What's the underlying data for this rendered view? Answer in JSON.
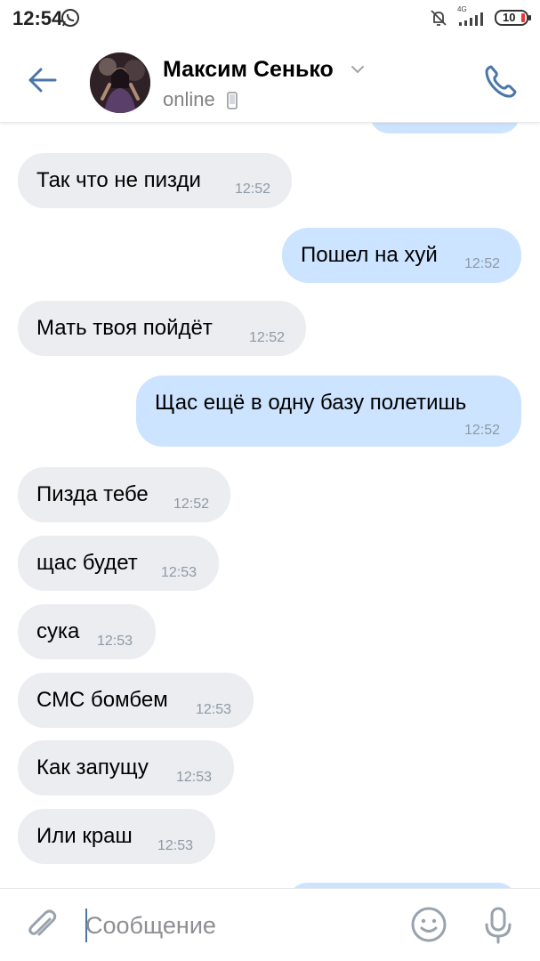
{
  "status_bar": {
    "time": "12:54",
    "network": "4G",
    "battery": "10",
    "icons": [
      "whatsapp-icon",
      "mute-icon",
      "signal-icon",
      "battery-icon"
    ]
  },
  "header": {
    "contact_name": "Максим Сенько",
    "status": "online",
    "icons": [
      "back-arrow-icon",
      "chevron-down-icon",
      "mobile-phone-icon",
      "phone-call-icon"
    ],
    "accent_color": "#4a76a8"
  },
  "messages": [
    {
      "direction": "in",
      "text": "Так что не пизди",
      "time": "12:52"
    },
    {
      "direction": "out",
      "text": "Пошел на хуй",
      "time": "12:52"
    },
    {
      "direction": "in",
      "text": "Мать твоя пойдёт",
      "time": "12:52"
    },
    {
      "direction": "out",
      "text": "Щас ещё в одну базу полетишь",
      "time": "12:52"
    },
    {
      "direction": "in",
      "text": "Пизда тебе",
      "time": "12:52"
    },
    {
      "direction": "in",
      "text": "щас будет",
      "time": "12:53"
    },
    {
      "direction": "in",
      "text": "сука",
      "time": "12:53"
    },
    {
      "direction": "in",
      "text": "СМС бомбем",
      "time": "12:53"
    },
    {
      "direction": "in",
      "text": "Как запущу",
      "time": "12:53"
    },
    {
      "direction": "in",
      "text": "Или краш",
      "time": "12:53"
    }
  ],
  "colors": {
    "incoming_bubble": "#ebedf0",
    "outgoing_bubble": "#cce4ff",
    "timestamp": "#8e99a5"
  },
  "input_bar": {
    "placeholder": "Сообщение",
    "value": "",
    "icons": [
      "paperclip-icon",
      "emoji-icon",
      "microphone-icon"
    ]
  }
}
